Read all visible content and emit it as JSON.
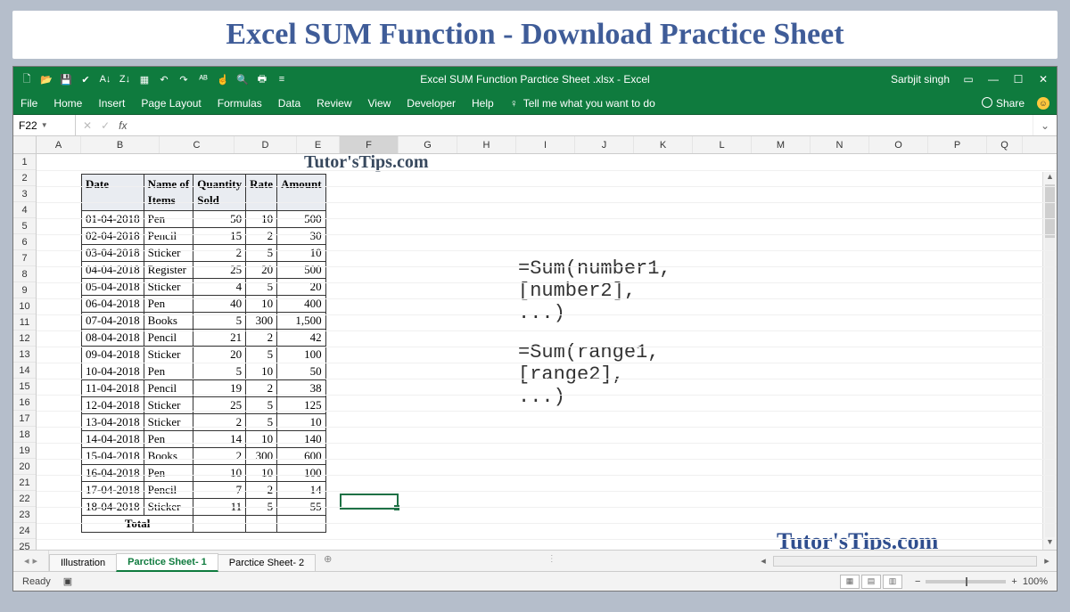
{
  "banner": {
    "title": "Excel SUM Function - Download Practice Sheet"
  },
  "titlebar": {
    "doc_title": "Excel SUM Function Parctice Sheet .xlsx  -  Excel",
    "user": "Sarbjit singh"
  },
  "qat_icons": [
    "new",
    "open",
    "save",
    "spellcheck",
    "sort-asc",
    "sort-desc",
    "table",
    "undo",
    "redo",
    "abc-check",
    "touch",
    "preview",
    "quickprint",
    "more"
  ],
  "ribbon": {
    "tabs": [
      "File",
      "Home",
      "Insert",
      "Page Layout",
      "Formulas",
      "Data",
      "Review",
      "View",
      "Developer",
      "Help"
    ],
    "tellme": "Tell me what you want to do",
    "share": "Share"
  },
  "fxbar": {
    "namebox": "F22",
    "formula": ""
  },
  "columns": [
    {
      "l": "A",
      "w": 50
    },
    {
      "l": "B",
      "w": 88
    },
    {
      "l": "C",
      "w": 84
    },
    {
      "l": "D",
      "w": 70
    },
    {
      "l": "E",
      "w": 48
    },
    {
      "l": "F",
      "w": 66
    },
    {
      "l": "G",
      "w": 66
    },
    {
      "l": "H",
      "w": 66
    },
    {
      "l": "I",
      "w": 66
    },
    {
      "l": "J",
      "w": 66
    },
    {
      "l": "K",
      "w": 66
    },
    {
      "l": "L",
      "w": 66
    },
    {
      "l": "M",
      "w": 66
    },
    {
      "l": "N",
      "w": 66
    },
    {
      "l": "O",
      "w": 66
    },
    {
      "l": "P",
      "w": 66
    },
    {
      "l": "Q",
      "w": 40
    }
  ],
  "row_count": 26,
  "watermark_top": "Tutor'sTips.com",
  "watermark_bottom": "Tutor'sTips.com",
  "table": {
    "headers": [
      "Date",
      "Name of Items",
      "Quantity Sold",
      "Rate",
      "Amount"
    ],
    "rows": [
      [
        "01-04-2018",
        "Pen",
        "50",
        "10",
        "500"
      ],
      [
        "02-04-2018",
        "Pencil",
        "15",
        "2",
        "30"
      ],
      [
        "03-04-2018",
        "Sticker",
        "2",
        "5",
        "10"
      ],
      [
        "04-04-2018",
        "Register",
        "25",
        "20",
        "500"
      ],
      [
        "05-04-2018",
        "Sticker",
        "4",
        "5",
        "20"
      ],
      [
        "06-04-2018",
        "Pen",
        "40",
        "10",
        "400"
      ],
      [
        "07-04-2018",
        "Books",
        "5",
        "300",
        "1,500"
      ],
      [
        "08-04-2018",
        "Pencil",
        "21",
        "2",
        "42"
      ],
      [
        "09-04-2018",
        "Sticker",
        "20",
        "5",
        "100"
      ],
      [
        "10-04-2018",
        "Pen",
        "5",
        "10",
        "50"
      ],
      [
        "11-04-2018",
        "Pencil",
        "19",
        "2",
        "38"
      ],
      [
        "12-04-2018",
        "Sticker",
        "25",
        "5",
        "125"
      ],
      [
        "13-04-2018",
        "Sticker",
        "2",
        "5",
        "10"
      ],
      [
        "14-04-2018",
        "Pen",
        "14",
        "10",
        "140"
      ],
      [
        "15-04-2018",
        "Books",
        "2",
        "300",
        "600"
      ],
      [
        "16-04-2018",
        "Pen",
        "10",
        "10",
        "100"
      ],
      [
        "17-04-2018",
        "Pencil",
        "7",
        "2",
        "14"
      ],
      [
        "18-04-2018",
        "Sticker",
        "11",
        "5",
        "55"
      ]
    ],
    "total_label": "Total"
  },
  "formulas": {
    "line1": "=Sum(number1, [number2], ...)",
    "line2": "=Sum(range1, [range2], ...)"
  },
  "sheets": {
    "tabs": [
      "Illustration",
      "Parctice Sheet- 1",
      "Parctice Sheet- 2"
    ],
    "active": 1
  },
  "status": {
    "ready": "Ready",
    "zoom": "100%"
  }
}
